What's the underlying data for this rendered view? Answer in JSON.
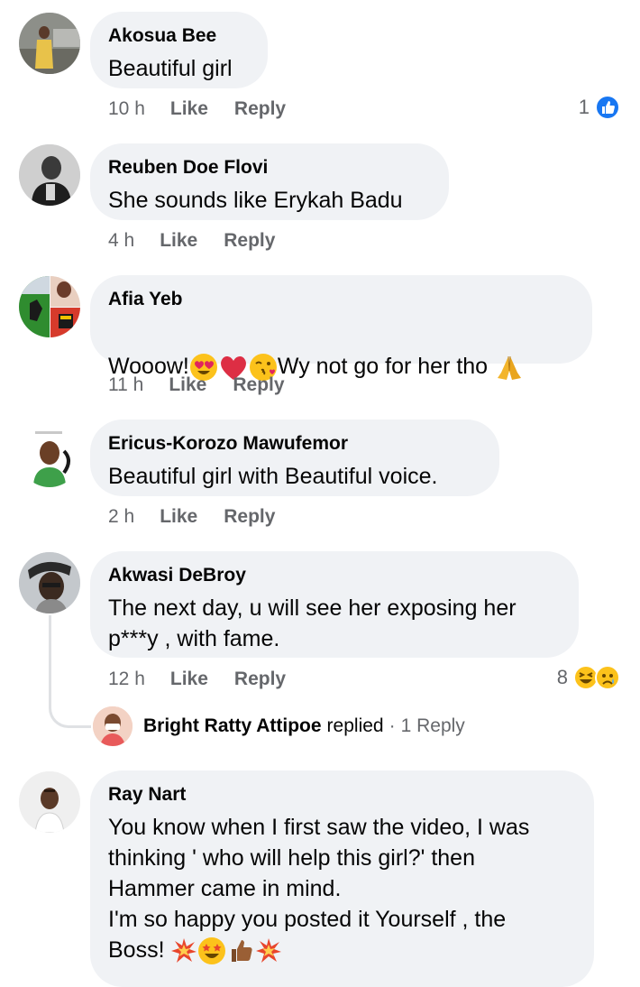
{
  "comments": [
    {
      "author": "Akosua Bee",
      "text": "Beautiful girl",
      "time": "10 h",
      "like": "Like",
      "reply": "Reply",
      "reaction_count": "1"
    },
    {
      "author": "Reuben Doe Flovi",
      "text": "She sounds like Erykah Badu",
      "time": "4 h",
      "like": "Like",
      "reply": "Reply"
    },
    {
      "author": "Afia Yeb",
      "text_a": "Wooow!",
      "text_b": "Wy not go for her tho",
      "time": "11 h",
      "like": "Like",
      "reply": "Reply"
    },
    {
      "author": "Ericus-Korozo Mawufemor",
      "text": "Beautiful girl with Beautiful voice.",
      "time": "2 h",
      "like": "Like",
      "reply": "Reply"
    },
    {
      "author": "Akwasi DeBroy",
      "text": "The next day, u will see her exposing her\np***y , with fame.",
      "time": "12 h",
      "like": "Like",
      "reply": "Reply",
      "reaction_count": "8"
    },
    {
      "author": "Ray Nart",
      "text": "You know when I first saw the video, I was\nthinking ' who will help this girl?' then\nHammer came in mind.\nI'm so happy you posted it Yourself , the\nBoss!"
    }
  ],
  "reply_preview": {
    "author": "Bright Ratty Attipoe",
    "action": "replied",
    "separator": "·",
    "count_label": "1 Reply"
  },
  "icons": {
    "like_reaction": "like-reaction-icon",
    "haha_reaction": "haha-reaction-icon",
    "sad_reaction": "sad-reaction-icon",
    "heart_eyes": "heart-eyes-emoji-icon",
    "red_heart": "red-heart-emoji-icon",
    "kiss": "face-blowing-kiss-emoji-icon",
    "pray": "folded-hands-emoji-icon",
    "collision": "collision-emoji-icon",
    "star_struck": "star-struck-emoji-icon",
    "thumbs_up": "thumbs-up-emoji-icon"
  },
  "colors": {
    "bubble": "#f0f2f5",
    "muted": "#65676b",
    "like_blue": "#1877f2",
    "text": "#050505"
  }
}
